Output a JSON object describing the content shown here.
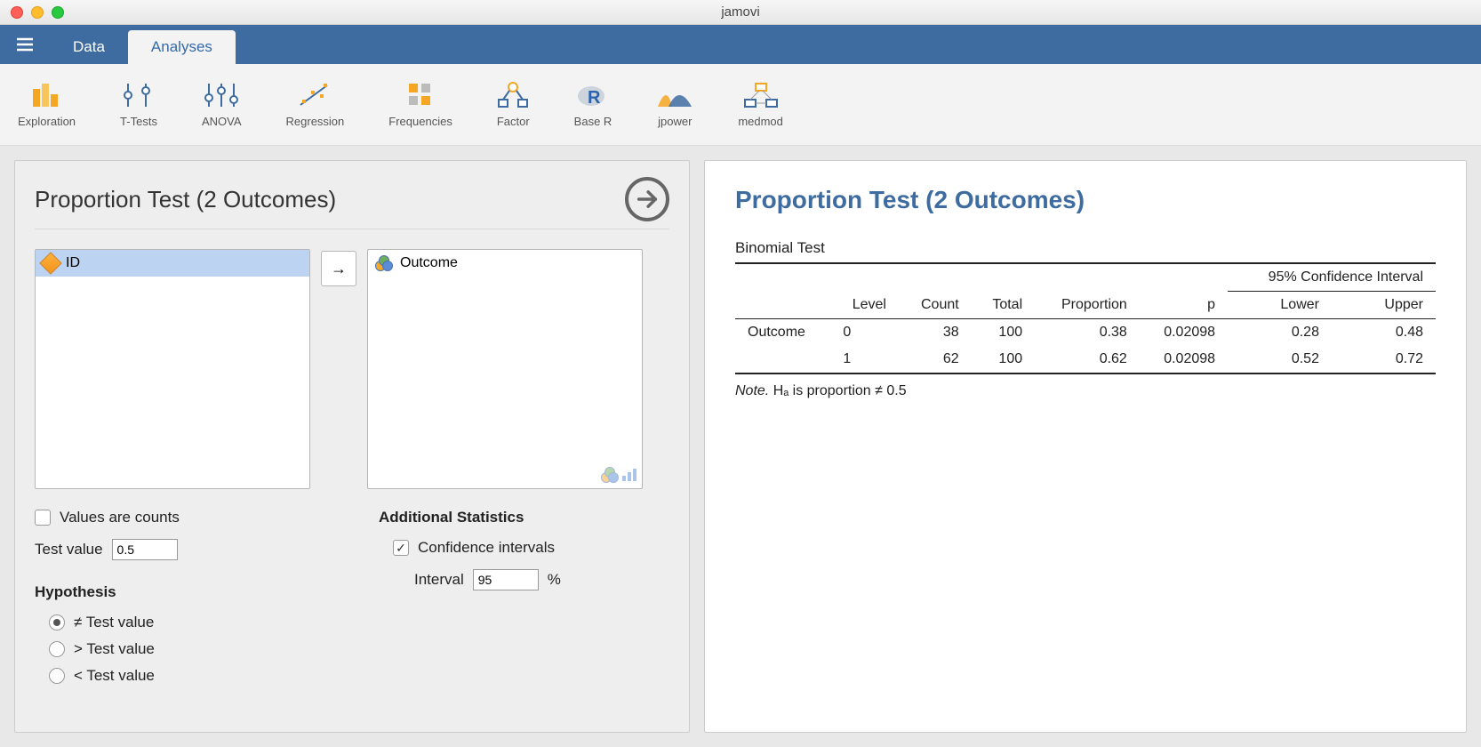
{
  "window": {
    "title": "jamovi"
  },
  "tabs": {
    "data": "Data",
    "analyses": "Analyses",
    "active": "analyses"
  },
  "toolbar": [
    {
      "id": "exploration",
      "label": "Exploration"
    },
    {
      "id": "ttests",
      "label": "T-Tests"
    },
    {
      "id": "anova",
      "label": "ANOVA"
    },
    {
      "id": "regression",
      "label": "Regression"
    },
    {
      "id": "frequencies",
      "label": "Frequencies"
    },
    {
      "id": "factor",
      "label": "Factor"
    },
    {
      "id": "baser",
      "label": "Base R"
    },
    {
      "id": "jpower",
      "label": "jpower"
    },
    {
      "id": "medmod",
      "label": "medmod"
    }
  ],
  "options": {
    "title": "Proportion Test (2 Outcomes)",
    "source_vars": [
      {
        "name": "ID",
        "selected": true
      }
    ],
    "target_vars": [
      {
        "name": "Outcome"
      }
    ],
    "values_are_counts": {
      "label": "Values are counts",
      "checked": false
    },
    "test_value": {
      "label": "Test value",
      "value": "0.5"
    },
    "hypothesis": {
      "heading": "Hypothesis",
      "options": [
        {
          "label": "≠ Test value",
          "checked": true
        },
        {
          "label": "> Test value",
          "checked": false
        },
        {
          "label": "< Test value",
          "checked": false
        }
      ]
    },
    "additional": {
      "heading": "Additional Statistics",
      "ci": {
        "label": "Confidence intervals",
        "checked": true
      },
      "interval": {
        "label": "Interval",
        "value": "95",
        "suffix": "%"
      }
    }
  },
  "results": {
    "title": "Proportion Test (2 Outcomes)",
    "table_title": "Binomial Test",
    "ci_header": "95% Confidence Interval",
    "columns": {
      "var": "",
      "level": "Level",
      "count": "Count",
      "total": "Total",
      "prop": "Proportion",
      "p": "p",
      "lower": "Lower",
      "upper": "Upper"
    },
    "rows": [
      {
        "var": "Outcome",
        "level": "0",
        "count": "38",
        "total": "100",
        "prop": "0.38",
        "p": "0.02098",
        "lower": "0.28",
        "upper": "0.48"
      },
      {
        "var": "",
        "level": "1",
        "count": "62",
        "total": "100",
        "prop": "0.62",
        "p": "0.02098",
        "lower": "0.52",
        "upper": "0.72"
      }
    ],
    "note_prefix": "Note.",
    "note_body": " Hₐ is proportion ≠ 0.5"
  },
  "chart_data": {
    "type": "table",
    "title": "Binomial Test — Proportion Test (2 Outcomes)",
    "variable": "Outcome",
    "hypothesis": "proportion ≠ 0.5",
    "confidence_level": 0.95,
    "columns": [
      "Level",
      "Count",
      "Total",
      "Proportion",
      "p",
      "CI Lower",
      "CI Upper"
    ],
    "rows": [
      {
        "Level": 0,
        "Count": 38,
        "Total": 100,
        "Proportion": 0.38,
        "p": 0.02098,
        "CI Lower": 0.28,
        "CI Upper": 0.48
      },
      {
        "Level": 1,
        "Count": 62,
        "Total": 100,
        "Proportion": 0.62,
        "p": 0.02098,
        "CI Lower": 0.52,
        "CI Upper": 0.72
      }
    ]
  }
}
